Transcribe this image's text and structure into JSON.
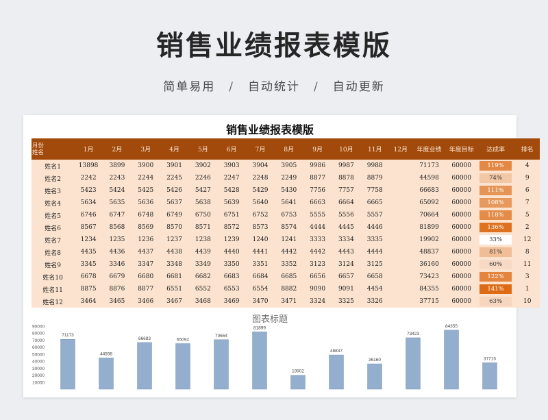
{
  "hero": {
    "title": "销售业绩报表模版",
    "tags": [
      "简单易用",
      "自动统计",
      "自动更新"
    ],
    "separator": "/"
  },
  "sheet": {
    "title": "销售业绩报表模版",
    "corner_top": "月份",
    "corner_bottom": "姓名",
    "headers": [
      "1月",
      "2月",
      "3月",
      "4月",
      "5月",
      "6月",
      "7月",
      "8月",
      "9月",
      "10月",
      "11月",
      "12月",
      "年度业绩",
      "年度目标",
      "达成率",
      "排名"
    ],
    "rows": [
      {
        "name": "姓名1",
        "months": [
          13898,
          3899,
          3900,
          3901,
          3902,
          3903,
          3904,
          3905,
          9986,
          9987,
          9988,
          ""
        ],
        "annual": 71173,
        "target": 60000,
        "rate": "119%",
        "rate_value": 1.19,
        "rank": 4
      },
      {
        "name": "姓名2",
        "months": [
          2242,
          2243,
          2244,
          2245,
          2246,
          2247,
          2248,
          2249,
          8877,
          8878,
          8879,
          ""
        ],
        "annual": 44598,
        "target": 60000,
        "rate": "74%",
        "rate_value": 0.74,
        "rank": 9
      },
      {
        "name": "姓名3",
        "months": [
          5423,
          5424,
          5425,
          5426,
          5427,
          5428,
          5429,
          5430,
          7756,
          7757,
          7758,
          ""
        ],
        "annual": 66683,
        "target": 60000,
        "rate": "111%",
        "rate_value": 1.11,
        "rank": 6
      },
      {
        "name": "姓名4",
        "months": [
          5634,
          5635,
          5636,
          5637,
          5638,
          5639,
          5640,
          5641,
          6663,
          6664,
          6665,
          ""
        ],
        "annual": 65092,
        "target": 60000,
        "rate": "108%",
        "rate_value": 1.08,
        "rank": 7
      },
      {
        "name": "姓名5",
        "months": [
          6746,
          6747,
          6748,
          6749,
          6750,
          6751,
          6752,
          6753,
          5555,
          5556,
          5557,
          ""
        ],
        "annual": 70664,
        "target": 60000,
        "rate": "118%",
        "rate_value": 1.18,
        "rank": 5
      },
      {
        "name": "姓名6",
        "months": [
          8567,
          8568,
          8569,
          8570,
          8571,
          8572,
          8573,
          8574,
          4444,
          4445,
          4446,
          ""
        ],
        "annual": 81899,
        "target": 60000,
        "rate": "136%",
        "rate_value": 1.36,
        "rank": 2
      },
      {
        "name": "姓名7",
        "months": [
          1234,
          1235,
          1236,
          1237,
          1238,
          1239,
          1240,
          1241,
          3333,
          3334,
          3335,
          ""
        ],
        "annual": 19902,
        "target": 60000,
        "rate": "33%",
        "rate_value": 0.33,
        "rank": 12
      },
      {
        "name": "姓名8",
        "months": [
          4435,
          4436,
          4437,
          4438,
          4439,
          4440,
          4441,
          4442,
          4442,
          4443,
          4444,
          ""
        ],
        "annual": 48837,
        "target": 60000,
        "rate": "81%",
        "rate_value": 0.81,
        "rank": 8
      },
      {
        "name": "姓名9",
        "months": [
          3345,
          3346,
          3347,
          3348,
          3349,
          3350,
          3351,
          3352,
          3123,
          3124,
          3125,
          ""
        ],
        "annual": 36160,
        "target": 60000,
        "rate": "60%",
        "rate_value": 0.6,
        "rank": 11
      },
      {
        "name": "姓名10",
        "months": [
          6678,
          6679,
          6680,
          6681,
          6682,
          6683,
          6684,
          6685,
          6656,
          6657,
          6658,
          ""
        ],
        "annual": 73423,
        "target": 60000,
        "rate": "122%",
        "rate_value": 1.22,
        "rank": 3
      },
      {
        "name": "姓名11",
        "months": [
          8875,
          8876,
          8877,
          6551,
          6552,
          6553,
          6554,
          8882,
          9090,
          9091,
          4454,
          ""
        ],
        "annual": 84355,
        "target": 60000,
        "rate": "141%",
        "rate_value": 1.41,
        "rank": 1
      },
      {
        "name": "姓名12",
        "months": [
          3464,
          3465,
          3466,
          3467,
          3468,
          3469,
          3470,
          3471,
          3324,
          3325,
          3326,
          ""
        ],
        "annual": 37715,
        "target": 60000,
        "rate": "63%",
        "rate_value": 0.63,
        "rank": 10
      }
    ]
  },
  "colors": {
    "header_bg": "#a24a0c",
    "row_bg": "#fbe3cf",
    "bar_fill": "#94aecd",
    "rate_high": "#dd6b15",
    "rate_low": "#ffffff"
  },
  "chart_data": {
    "type": "bar",
    "title": "图表标题",
    "values": [
      71173,
      44598,
      66683,
      65092,
      70664,
      81899,
      19902,
      48837,
      36160,
      73423,
      84355,
      37715
    ],
    "y_ticks": [
      10000,
      20000,
      30000,
      40000,
      50000,
      60000,
      70000,
      80000,
      90000
    ],
    "ylim": [
      0,
      90000
    ],
    "grid": false,
    "legend": "none"
  }
}
